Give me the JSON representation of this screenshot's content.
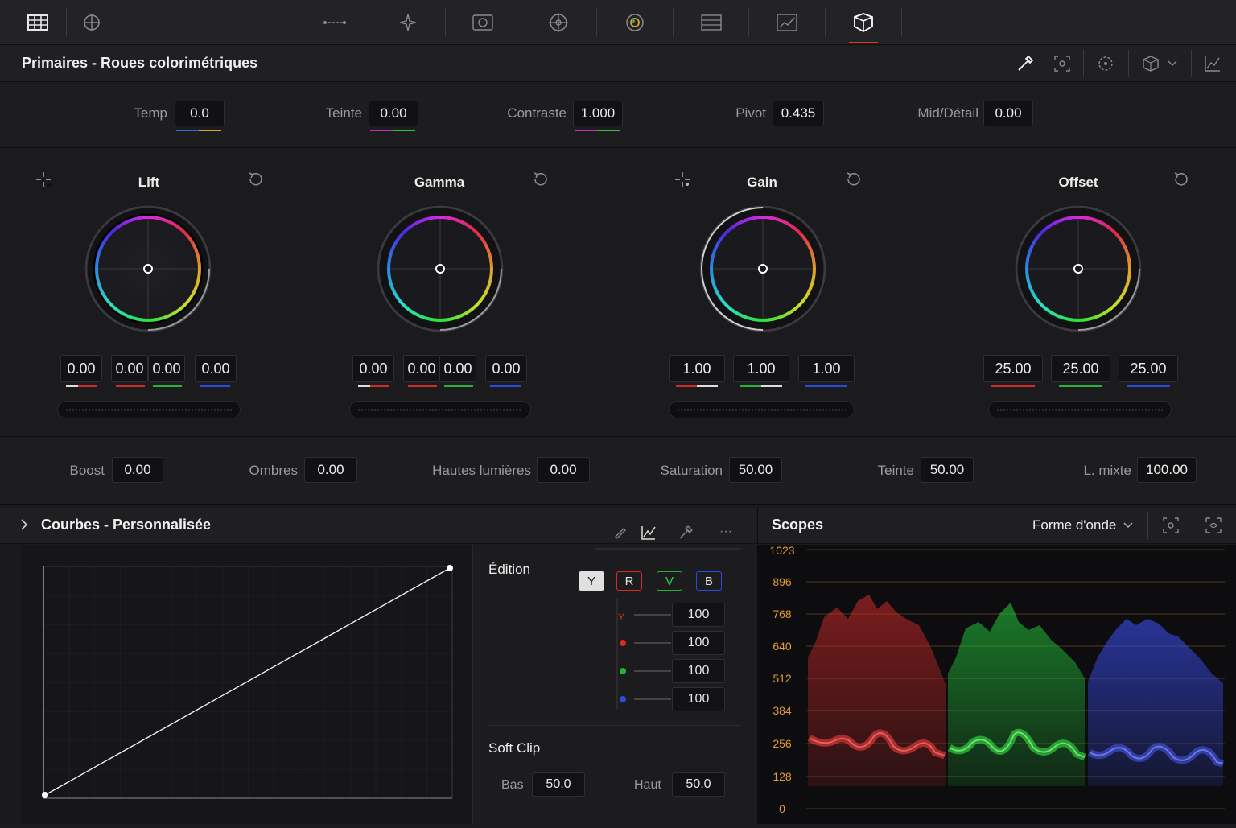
{
  "toolbar": {
    "icons": [
      "grid-icon",
      "crosshair-icon",
      "horizontal-dots-icon",
      "star-icon",
      "camera-icon",
      "target-icon",
      "color-icon",
      "layers-icon",
      "chart-icon",
      "cube-icon"
    ]
  },
  "panel": {
    "title": "Primaires - Roues colorimétriques"
  },
  "params": {
    "temp": {
      "label": "Temp",
      "value": "0.0"
    },
    "tint": {
      "label": "Teinte",
      "value": "0.00"
    },
    "contrast": {
      "label": "Contraste",
      "value": "1.000"
    },
    "pivot": {
      "label": "Pivot",
      "value": "0.435"
    },
    "middetail": {
      "label": "Mid/Détail",
      "value": "0.00"
    }
  },
  "wheels": {
    "lift": {
      "title": "Lift",
      "values": [
        "0.00",
        "0.00",
        "0.00",
        "0.00"
      ]
    },
    "gamma": {
      "title": "Gamma",
      "values": [
        "0.00",
        "0.00",
        "0.00",
        "0.00"
      ]
    },
    "gain": {
      "title": "Gain",
      "values": [
        "1.00",
        "1.00",
        "1.00"
      ]
    },
    "offset": {
      "title": "Offset",
      "values": [
        "25.00",
        "25.00",
        "25.00"
      ]
    }
  },
  "bottom": {
    "boost": {
      "label": "Boost",
      "value": "0.00"
    },
    "shadows": {
      "label": "Ombres",
      "value": "0.00"
    },
    "highlights": {
      "label": "Hautes lumières",
      "value": "0.00"
    },
    "saturation": {
      "label": "Saturation",
      "value": "50.00"
    },
    "hue": {
      "label": "Teinte",
      "value": "50.00"
    },
    "lummix": {
      "label": "L. mixte",
      "value": "100.00"
    }
  },
  "curves": {
    "title": "Courbes - Personnalisée",
    "edit_label": "Édition",
    "channels": [
      "Y",
      "R",
      "V",
      "B"
    ],
    "mix_values": [
      "100",
      "100",
      "100",
      "100"
    ],
    "softclip": {
      "title": "Soft Clip",
      "low_label": "Bas",
      "low_value": "50.0",
      "high_label": "Haut",
      "high_value": "50.0"
    }
  },
  "scopes": {
    "title": "Scopes",
    "mode": "Forme d'onde",
    "scale": [
      "1023",
      "896",
      "768",
      "640",
      "512",
      "384",
      "256",
      "128",
      "0"
    ]
  },
  "colors": {
    "accent_red": "#e0312e",
    "scale_orange": "#e09a3c",
    "red": "#d42a2a",
    "green": "#23b23a",
    "blue": "#2a4be0"
  }
}
